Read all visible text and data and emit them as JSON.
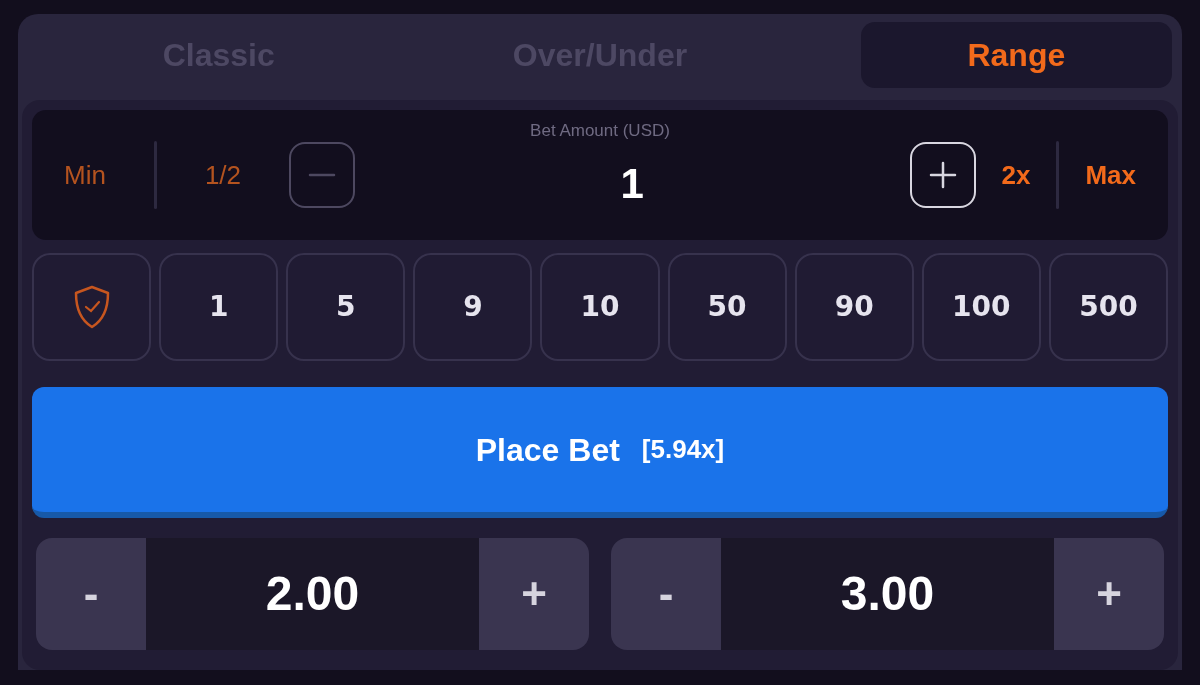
{
  "tabs": [
    {
      "label": "Classic",
      "selected": false
    },
    {
      "label": "Over/Under",
      "selected": false
    },
    {
      "label": "Range",
      "selected": true
    }
  ],
  "bet_amount": {
    "label": "Bet Amount (USD)",
    "value": "1",
    "left": [
      {
        "kind": "text",
        "label": "Min",
        "disabled": true
      },
      {
        "kind": "divider"
      },
      {
        "kind": "text",
        "label": "1/2",
        "disabled": true
      },
      {
        "kind": "minus",
        "disabled": true
      }
    ],
    "right": [
      {
        "kind": "plus",
        "disabled": false
      },
      {
        "kind": "text",
        "label": "2x",
        "disabled": false
      },
      {
        "kind": "divider"
      },
      {
        "kind": "text",
        "label": "Max",
        "disabled": false
      }
    ]
  },
  "chips": [
    {
      "kind": "shield"
    },
    {
      "kind": "amount",
      "label": "1"
    },
    {
      "kind": "amount",
      "label": "5"
    },
    {
      "kind": "amount",
      "label": "9"
    },
    {
      "kind": "amount",
      "label": "10"
    },
    {
      "kind": "amount",
      "label": "50"
    },
    {
      "kind": "amount",
      "label": "90"
    },
    {
      "kind": "amount",
      "label": "100"
    },
    {
      "kind": "amount",
      "label": "500"
    }
  ],
  "place_bet": {
    "label": "Place Bet",
    "multiplier": "[5.94x]"
  },
  "range_inputs": [
    {
      "decrement": "-",
      "value": "2.00",
      "increment": "+"
    },
    {
      "decrement": "-",
      "value": "3.00",
      "increment": "+"
    }
  ]
}
